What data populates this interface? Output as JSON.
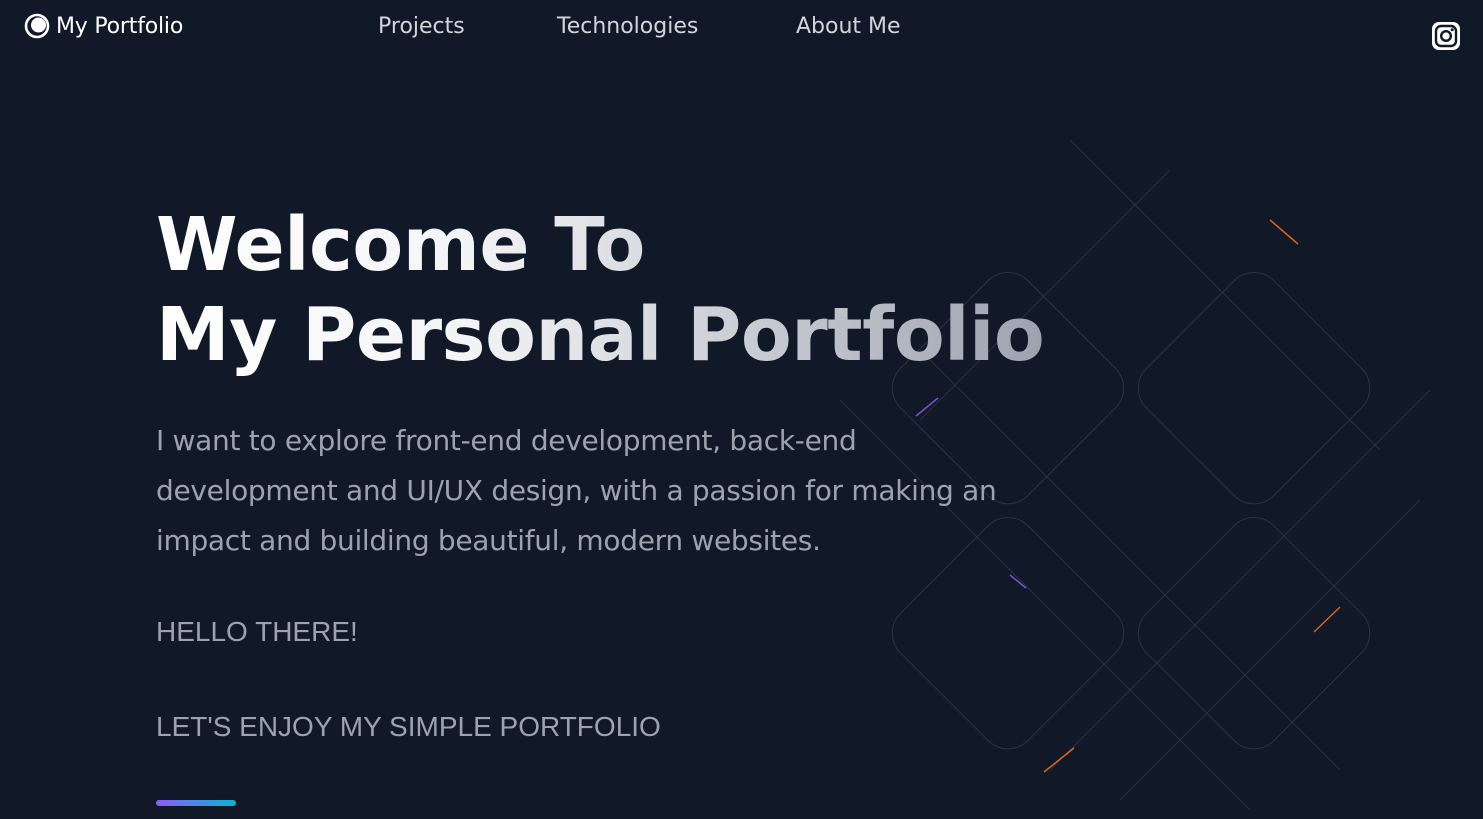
{
  "nav": {
    "brand": "My Portfolio",
    "links": [
      "Projects",
      "Technologies",
      "About Me"
    ],
    "social_icon": "instagram-icon"
  },
  "hero": {
    "title_line1": "Welcome To",
    "title_line2": "My Personal Portfolio",
    "description": "I want to explore front-end development, back-end development and UI/UX design, with a passion for making an impact and building beautiful, modern websites.",
    "greeting": "HELLO THERE!",
    "tagline": "LET'S ENJOY MY SIMPLE PORTFOLIO"
  },
  "colors": {
    "background": "#111827",
    "heading": "#ffffff",
    "body_text": "#9ca3af",
    "accent_start": "#8b5cf6",
    "accent_end": "#06b6d4"
  }
}
